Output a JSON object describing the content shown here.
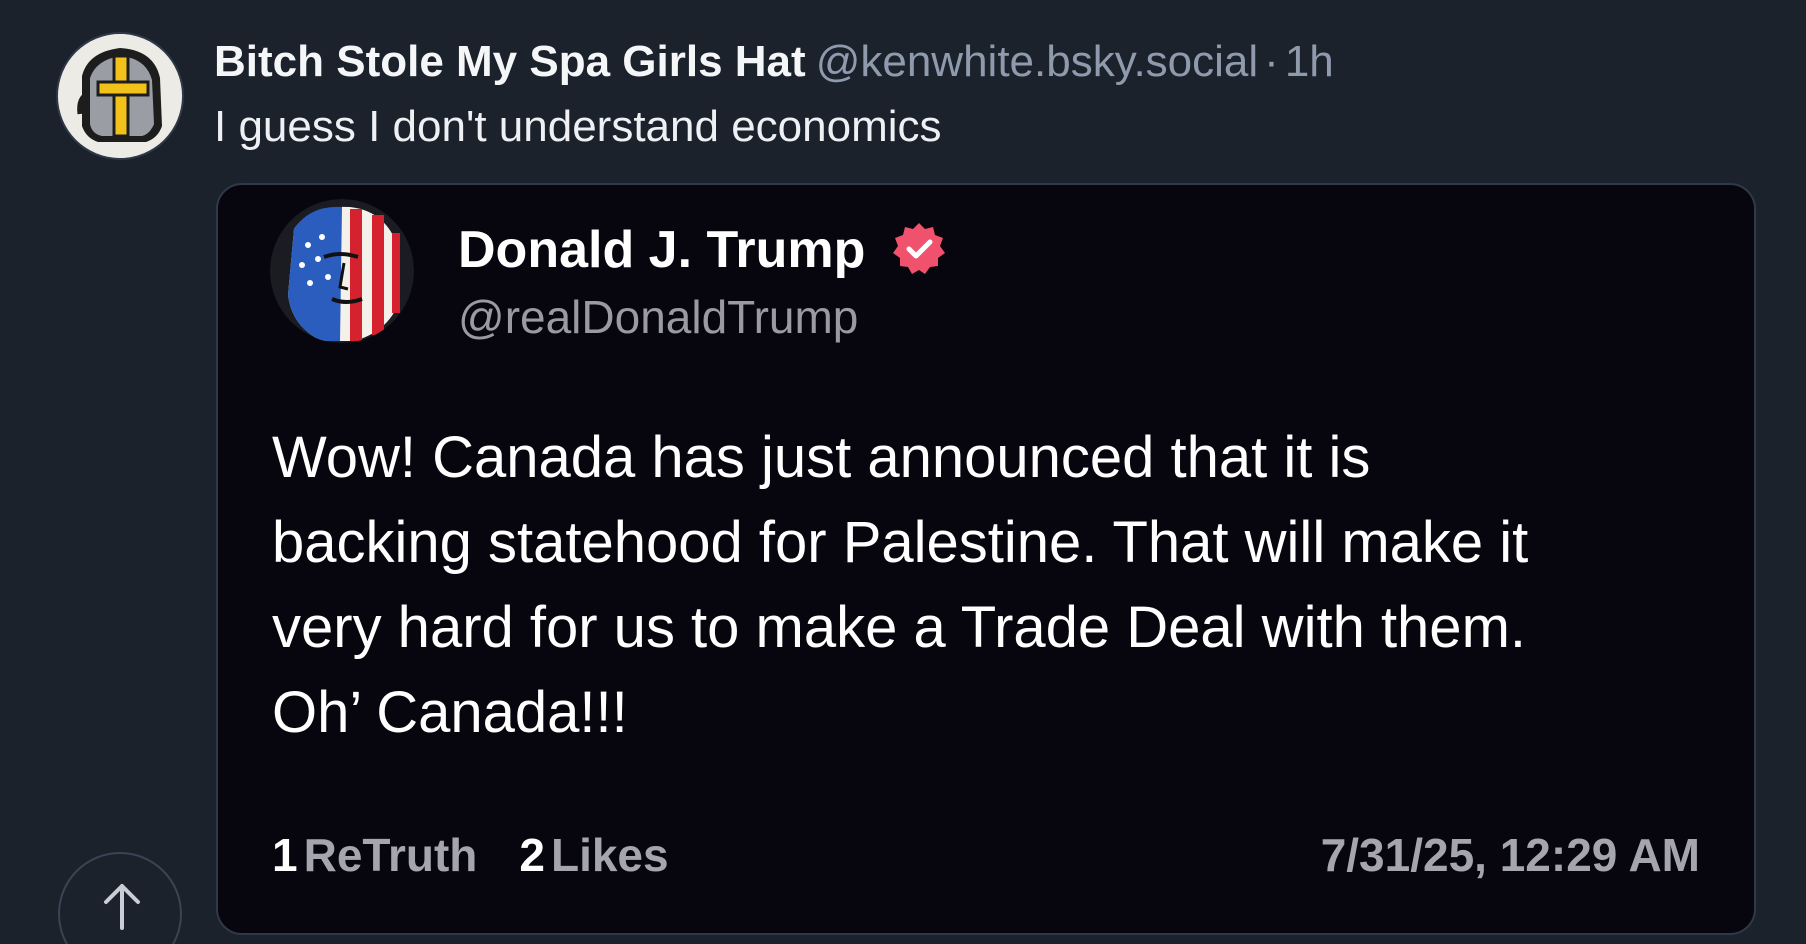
{
  "post": {
    "author": {
      "display_name": "Bitch Stole My Spa Girls Hat",
      "handle": "@kenwhite.bsky.social",
      "separator": "·",
      "time_ago": "1h",
      "avatar_icon": "helmet-cross-icon"
    },
    "text": "I guess I don't understand economics"
  },
  "quoted_post": {
    "author": {
      "name": "Donald J. Trump",
      "handle": "@realDonaldTrump",
      "verified": true,
      "verified_icon": "verified-badge-icon",
      "badge_color": "#f0526d",
      "avatar_icon": "flag-face-icon"
    },
    "body_lines": [
      "Wow! Canada has just announced that it is",
      "backing statehood for Palestine. That will make it",
      "very hard for us to make a Trade Deal with them.",
      "Oh’ Canada!!!"
    ],
    "stats": {
      "retruth_count": "1",
      "retruth_label": "ReTruth",
      "likes_count": "2",
      "likes_label": "Likes"
    },
    "timestamp": "7/31/25, 12:29 AM"
  },
  "controls": {
    "scroll_top_icon": "arrow-up-icon"
  },
  "colors": {
    "background": "#1b222c",
    "quote_background": "#07060f",
    "muted_text": "#8f9bad"
  }
}
